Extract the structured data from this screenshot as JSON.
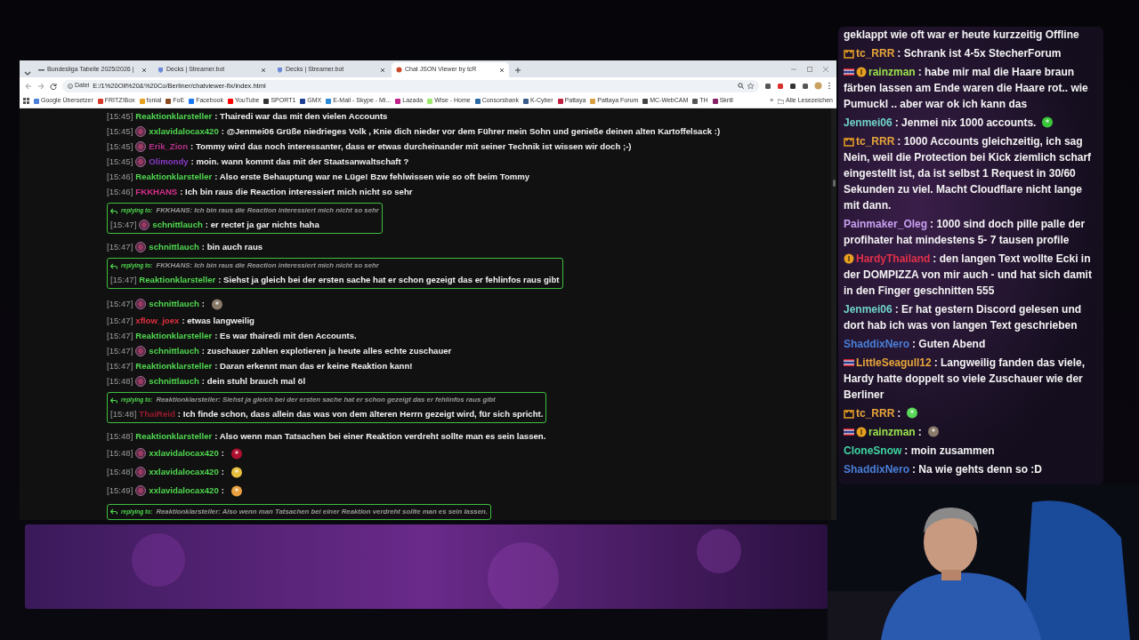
{
  "browser": {
    "tabs": [
      {
        "title": "Bundesliga Tabelle 2025/2026 |",
        "selected": false
      },
      {
        "title": "Decks | Streamer.bot",
        "selected": false
      },
      {
        "title": "Decks | Streamer.bot",
        "selected": false
      },
      {
        "title": "Chat JSON Viewer by tcR",
        "selected": true
      }
    ],
    "address_label": "Datei",
    "address": "E:/1%20Oll%20&%20Co/Berliner/chatviewer-fix/index.html",
    "bookmarks": [
      {
        "label": "Google Übersetzer",
        "color": "#4a7fd8"
      },
      {
        "label": "FRITZ!Box",
        "color": "#d83a2a"
      },
      {
        "label": "fonial",
        "color": "#e8a020"
      },
      {
        "label": "FoE",
        "color": "#8a4a20"
      },
      {
        "label": "Facebook",
        "color": "#1877f2"
      },
      {
        "label": "YouTube",
        "color": "#ff0000"
      },
      {
        "label": "SPORT1",
        "color": "#333333"
      },
      {
        "label": "GMX",
        "color": "#1c3f94"
      },
      {
        "label": "E-Mail - Skype - Mi...",
        "color": "#2a8ad8"
      },
      {
        "label": "Lazada",
        "color": "#c0208a"
      },
      {
        "label": "Wise - Home",
        "color": "#9fe870"
      },
      {
        "label": "Consorsbank",
        "color": "#2a6aa8"
      },
      {
        "label": "K-Cyber",
        "color": "#3a5a8a"
      },
      {
        "label": "Pattaya",
        "color": "#c02040"
      },
      {
        "label": "Pattaya Forum",
        "color": "#d8a040"
      },
      {
        "label": "MC-WebCAM",
        "color": "#444444"
      },
      {
        "label": "TH",
        "color": "#555555"
      },
      {
        "label": "Skrill",
        "color": "#862165"
      }
    ],
    "more": "»",
    "all_bookmarks": "Alle Lesezeichen"
  },
  "chat_viewer": {
    "messages": [
      {
        "time": "[15:45]",
        "user": "Reaktionklarsteller",
        "color": "#4fd84f",
        "avatar": false,
        "text": ": Thairedi war das mit den vielen Accounts"
      },
      {
        "time": "[15:45]",
        "user": "xxlavidalocax420",
        "color": "#4fd84f",
        "avatar": true,
        "text": ": @Jenmei06 Grüße niedrieges Volk , Knie dich nieder vor dem Führer mein Sohn und genieße deinen alten Kartoffelsack :)"
      },
      {
        "time": "[15:45]",
        "user": "Erik_Zion",
        "color": "#b8308a",
        "avatar": true,
        "text": ": Tommy wird das noch interessanter, dass er etwas durcheinander mit seiner Technik ist wissen wir doch ;-)"
      },
      {
        "time": "[15:45]",
        "user": "Olimondy",
        "color": "#8a3ac8",
        "avatar": true,
        "text": ": moin. wann kommt das mit der Staatsanwaltschaft ?"
      },
      {
        "time": "[15:46]",
        "user": "Reaktionklarsteller",
        "color": "#4fd84f",
        "avatar": false,
        "text": ": Also erste Behauptung war ne Lüge! Bzw fehlwissen wie so oft beim Tommy"
      },
      {
        "time": "[15:46]",
        "user": "FKKHANS",
        "color": "#d8308a",
        "avatar": false,
        "text": ": Ich bin raus die Reaction interessiert mich nicht so sehr"
      },
      {
        "reply_label": "replying to:",
        "reply_text": "FKKHANS: Ich bin raus die Reaction interessiert mich nicht so sehr",
        "time": "[15:47]",
        "user": "schnittlauch",
        "color": "#4fd84f",
        "avatar": true,
        "text": ": er rectet ja gar nichts haha"
      },
      {
        "time": "[15:47]",
        "user": "schnittlauch",
        "color": "#4fd84f",
        "avatar": true,
        "text": ": bin auch raus"
      },
      {
        "reply_label": "replying to:",
        "reply_text": "FKKHANS: Ich bin raus die Reaction interessiert mich nicht so sehr",
        "time": "[15:47]",
        "user": "Reaktionklarsteller",
        "color": "#4fd84f",
        "avatar": false,
        "text": ": Siehst ja gleich bei der ersten sache hat er schon gezeigt das er fehlinfos raus gibt"
      },
      {
        "time": "[15:47]",
        "user": "schnittlauch",
        "color": "#4fd84f",
        "avatar": true,
        "text": ":",
        "kind": "emote"
      },
      {
        "time": "[15:47]",
        "user": "xflow_joex",
        "color": "#e03040",
        "avatar": false,
        "text": ": etwas langweilig"
      },
      {
        "time": "[15:47]",
        "user": "Reaktionklarsteller",
        "color": "#4fd84f",
        "avatar": false,
        "text": ": Es war thairedi mit den Accounts."
      },
      {
        "time": "[15:47]",
        "user": "schnittlauch",
        "color": "#4fd84f",
        "avatar": true,
        "text": ": zuschauer zahlen explotieren ja heute alles echte zuschauer"
      },
      {
        "time": "[15:47]",
        "user": "Reaktionklarsteller",
        "color": "#4fd84f",
        "avatar": false,
        "text": ": Daran erkennt man das er keine Reaktion kann!"
      },
      {
        "time": "[15:48]",
        "user": "schnittlauch",
        "color": "#4fd84f",
        "avatar": true,
        "text": ": dein stuhl brauch mal öl"
      },
      {
        "reply_label": "replying to:",
        "reply_text": "Reaktionklarsteller: Siehst ja gleich bei der ersten sache hat er schon gezeigt das er fehlinfos raus gibt",
        "time": "[15:48]",
        "user": "ThaiReid",
        "color": "#9a1a30",
        "avatar": false,
        "text": ": Ich finde schon, dass allein das was von dem älteren Herrn gezeigt wird, für sich spricht."
      },
      {
        "time": "[15:48]",
        "user": "Reaktionklarsteller",
        "color": "#4fd84f",
        "avatar": false,
        "text": ": Also wenn man Tatsachen bei einer Reaktion verdreht sollte man es sein lassen."
      },
      {
        "time": "[15:48]",
        "user": "xxlavidalocax420",
        "color": "#4fd84f",
        "avatar": true,
        "text": ":",
        "kind": "emote"
      },
      {
        "time": "[15:48]",
        "user": "xxlavidalocax420",
        "color": "#4fd84f",
        "avatar": true,
        "text": ":",
        "kind": "emote"
      },
      {
        "time": "[15:49]",
        "user": "xxlavidalocax420",
        "color": "#4fd84f",
        "avatar": true,
        "text": ":",
        "kind": "emote"
      },
      {
        "reply_label": "replying to:",
        "reply_text": "Reaktionklarsteller: Also wenn man Tatsachen bei einer Reaktion verdreht sollte man es sein lassen."
      }
    ]
  },
  "overlay_chat": {
    "messages": [
      {
        "text": "geklappt wie oft war er heute kurzzeitig Offline"
      },
      {
        "badges": [
          {
            "kind": "crown"
          }
        ],
        "user": "tc_RRR",
        "color": "#e8a63a",
        "text": ": Schrank ist 4-5x StecherForum"
      },
      {
        "badges": [
          {
            "kind": "flag"
          },
          {
            "kind": "coin"
          }
        ],
        "user": "rainzman",
        "color": "#9be34a",
        "text": ": habe mir mal die Haare braun färben lassen am Ende waren die Haare rot.. wie Pumuckl .. aber war ok ich kann das"
      },
      {
        "user": "Jenmei06",
        "color": "#6fd3c8",
        "text": ": Jenmei nix 1000 accounts.",
        "kind": "emote"
      },
      {
        "badges": [
          {
            "kind": "crown"
          }
        ],
        "user": "tc_RRR",
        "color": "#e8a63a",
        "text": ": 1000 Accounts gleichzeitig, ich sag Nein, weil die Protection bei Kick ziemlich scharf eingestellt ist, da ist selbst 1 Request in 30/60 Sekunden zu viel. Macht Cloudflare nicht lange mit dann."
      },
      {
        "user": "Painmaker_Oleg",
        "color": "#c8a0f0",
        "text": ": 1000 sind doch pille palle der profihater hat mindestens 5- 7 tausen profile"
      },
      {
        "badges": [
          {
            "kind": "coin"
          }
        ],
        "user": "HardyThailand",
        "color": "#e0304a",
        "text": ": den langen Text wollte Ecki in der DOMPIZZA von mir auch - und hat sich damit in den Finger geschnitten 555"
      },
      {
        "user": "Jenmei06",
        "color": "#6fd3c8",
        "text": ": Er hat gestern Discord gelesen und dort hab ich was von langen Text geschrieben"
      },
      {
        "user": "ShaddixNero",
        "color": "#4a7fd8",
        "text": ": Guten Abend"
      },
      {
        "badges": [
          {
            "kind": "flag"
          }
        ],
        "user": "LittleSeagull12",
        "color": "#e8a63a",
        "text": ": Langweilig fanden das viele, Hardy hatte doppelt so viele Zuschauer wie der Berliner"
      },
      {
        "badges": [
          {
            "kind": "crown"
          }
        ],
        "user": "tc_RRR",
        "color": "#e8a63a",
        "text": ":",
        "kind": "emote"
      },
      {
        "badges": [
          {
            "kind": "flag"
          },
          {
            "kind": "coin"
          }
        ],
        "user": "rainzman",
        "color": "#9be34a",
        "text": ":",
        "kind": "emote"
      },
      {
        "user": "CloneSnow",
        "color": "#3fd3a0",
        "text": ": moin zusammen"
      },
      {
        "user": "ShaddixNero",
        "color": "#4a7fd8",
        "text": ": Na wie gehts denn so :D"
      }
    ]
  }
}
